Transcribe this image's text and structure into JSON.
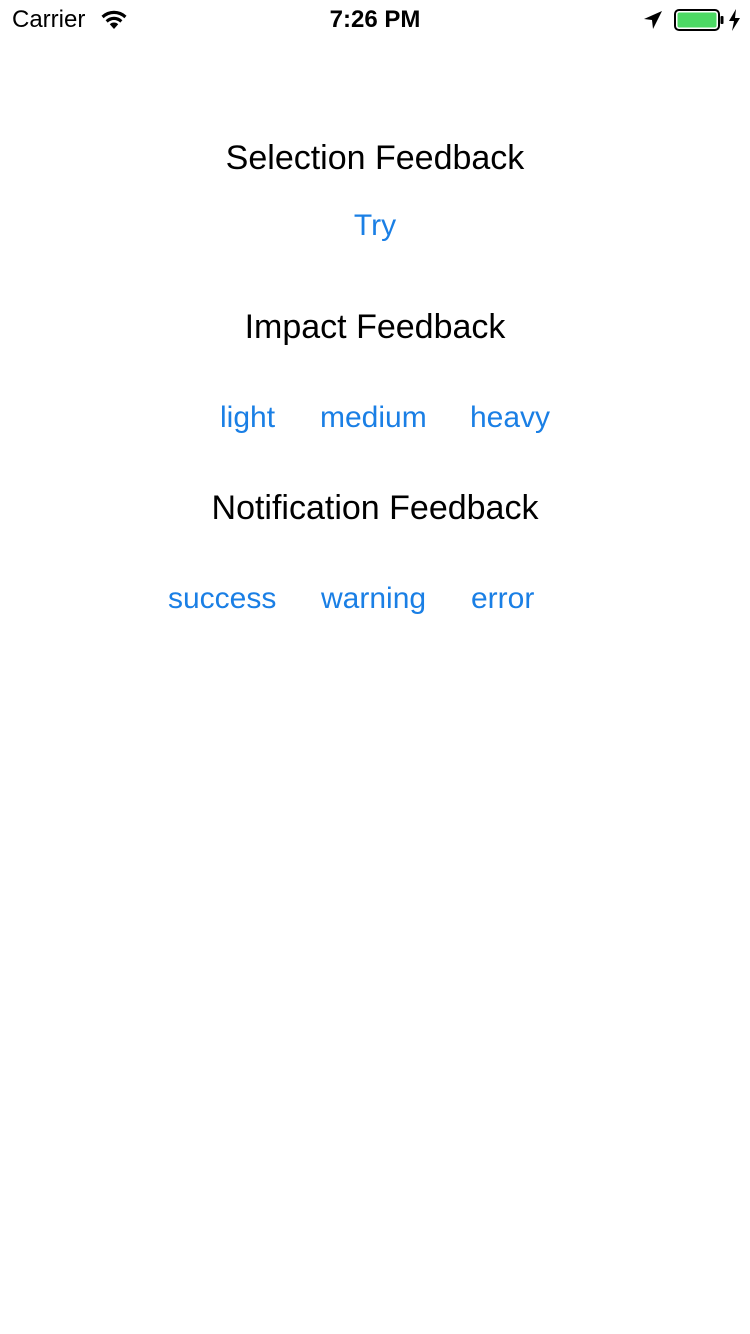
{
  "status_bar": {
    "carrier": "Carrier",
    "time": "7:26 PM",
    "battery_level": 1.0,
    "battery_color": "#4cd964",
    "icons": [
      "wifi-icon",
      "location-arrow-icon",
      "battery-icon",
      "charging-bolt-icon"
    ]
  },
  "sections": {
    "selection": {
      "title": "Selection Feedback",
      "try_label": "Try"
    },
    "impact": {
      "title": "Impact Feedback",
      "light_label": "light",
      "medium_label": "medium",
      "heavy_label": "heavy"
    },
    "notification": {
      "title": "Notification Feedback",
      "success_label": "success",
      "warning_label": "warning",
      "error_label": "error"
    }
  },
  "colors": {
    "tint": "#1a7fe5",
    "text": "#000000",
    "background": "#ffffff"
  }
}
